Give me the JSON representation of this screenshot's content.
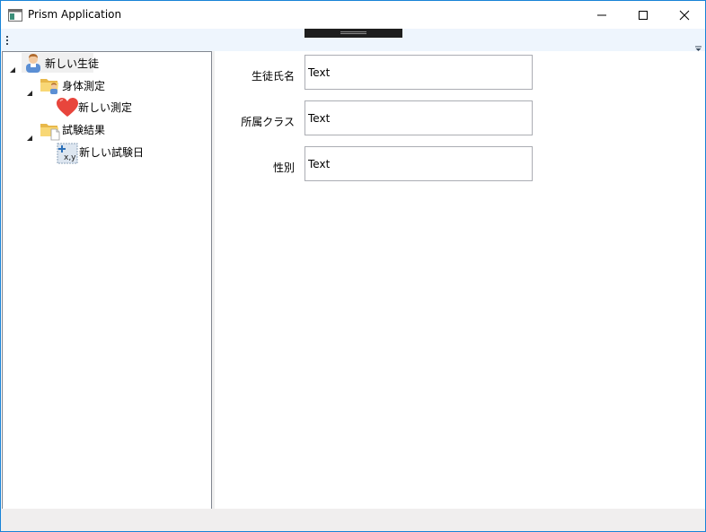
{
  "window": {
    "title": "Prism Application",
    "accent_color": "#1883d7"
  },
  "title_buttons": {
    "minimize_icon": "minimize-icon",
    "maximize_icon": "maximize-icon",
    "close_icon": "close-icon"
  },
  "tree": {
    "items": [
      {
        "label": "新しい生徒",
        "icon": "student-icon",
        "expanded": true
      },
      {
        "label": "身体測定",
        "icon": "folder-person-icon",
        "expanded": true
      },
      {
        "label": "新しい測定",
        "icon": "heart-icon"
      },
      {
        "label": "試験結果",
        "icon": "folder-document-icon",
        "expanded": true
      },
      {
        "label": "新しい試験日",
        "icon": "xy-add-icon"
      }
    ]
  },
  "form": {
    "fields": [
      {
        "label": "生徒氏名",
        "value": "Text"
      },
      {
        "label": "所属クラス",
        "value": "Text"
      },
      {
        "label": "性別",
        "value": "Text"
      }
    ]
  }
}
